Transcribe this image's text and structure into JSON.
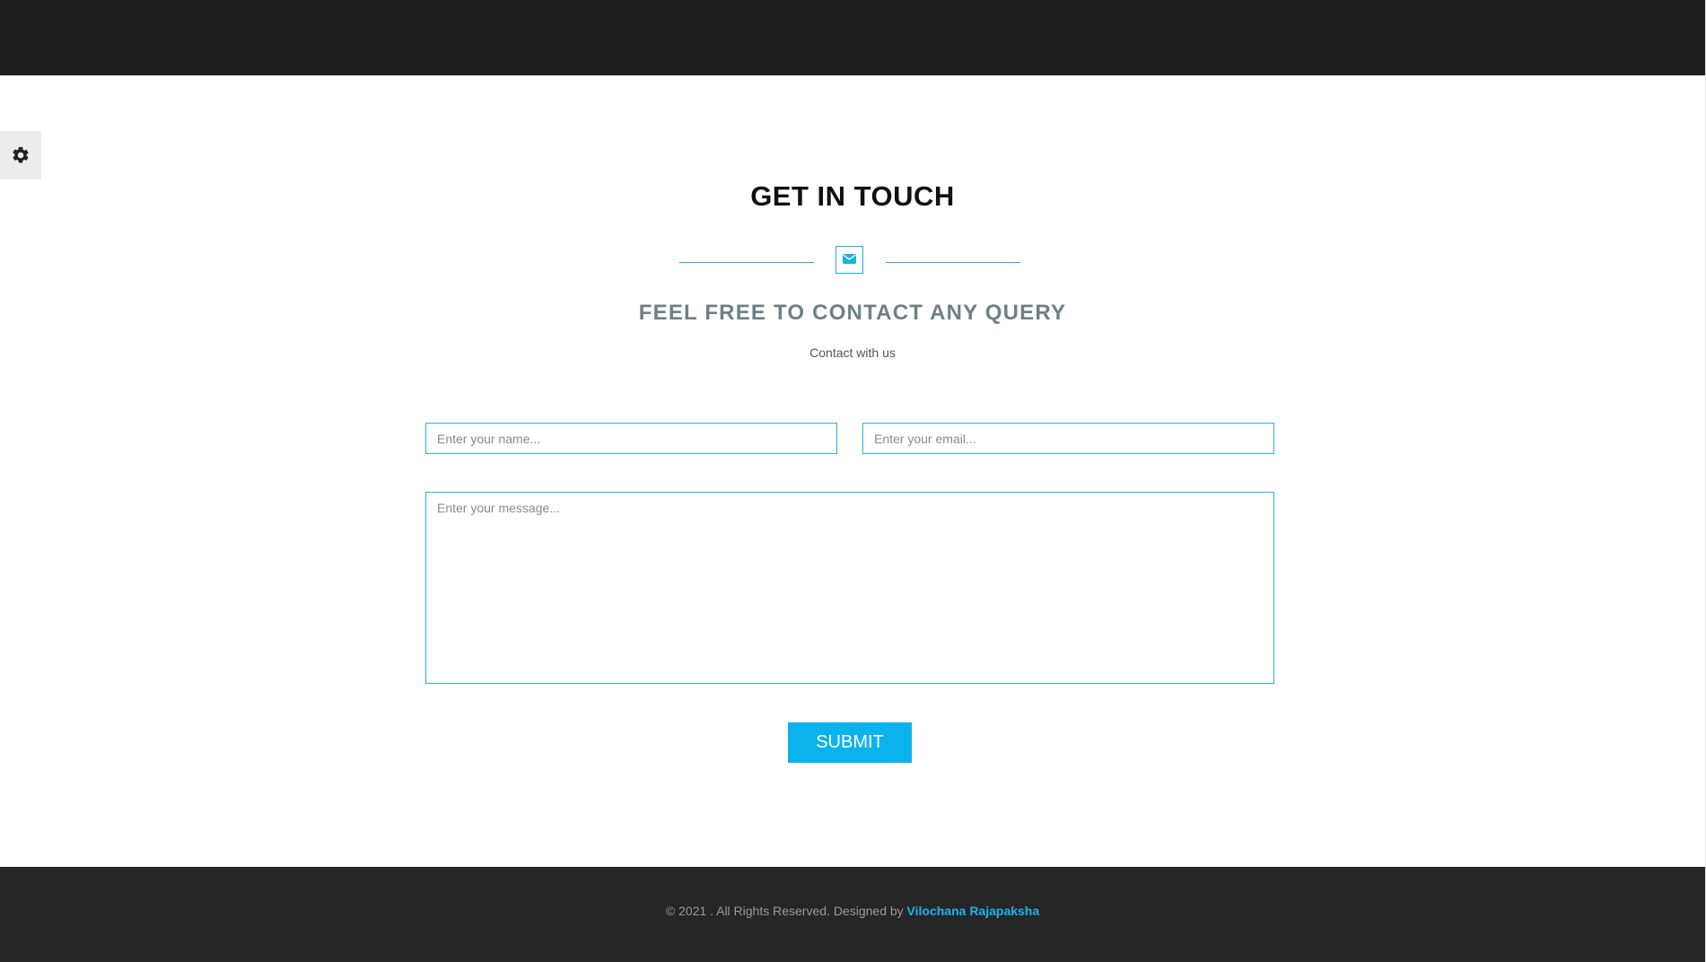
{
  "settings": {
    "icon": "gear-icon"
  },
  "contact": {
    "title": "GET IN TOUCH",
    "divider_icon": "envelope-icon",
    "subtitle": "FEEL FREE TO CONTACT ANY QUERY",
    "tagline": "Contact with us",
    "name_placeholder": "Enter your name...",
    "email_placeholder": "Enter your email...",
    "message_placeholder": "Enter your message...",
    "submit_label": "SUBMIT"
  },
  "footer": {
    "copyright": "© 2021 . All Rights Reserved. Designed by",
    "designer": "Vilochana Rajapaksha"
  },
  "colors": {
    "top_bar": "#1f1f1f",
    "accent": "#0bb3ed",
    "footer_bg": "#262626",
    "subtitle": "#6f7f85"
  }
}
